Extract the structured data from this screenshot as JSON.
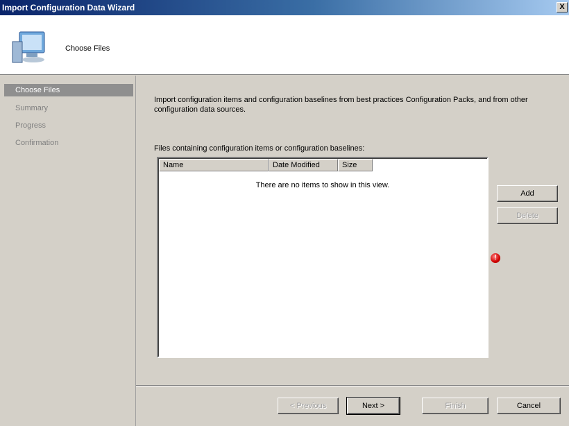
{
  "window": {
    "title": "Import Configuration Data Wizard",
    "close_label": "X"
  },
  "header": {
    "title": "Choose Files"
  },
  "steps": [
    {
      "label": "Choose Files",
      "active": true
    },
    {
      "label": "Summary",
      "active": false
    },
    {
      "label": "Progress",
      "active": false
    },
    {
      "label": "Confirmation",
      "active": false
    }
  ],
  "content": {
    "intro": "Import configuration items and configuration baselines from best practices Configuration Packs, and from other configuration data sources.",
    "list_label": "Files containing configuration items or configuration baselines:",
    "columns": [
      "Name",
      "Date Modified",
      "Size"
    ],
    "empty_message": "There are no items to show in this view.",
    "error_glyph": "!"
  },
  "buttons": {
    "add": "Add",
    "delete": "Delete",
    "previous": "< Previous",
    "next": "Next >",
    "finish": "Finish",
    "cancel": "Cancel"
  }
}
